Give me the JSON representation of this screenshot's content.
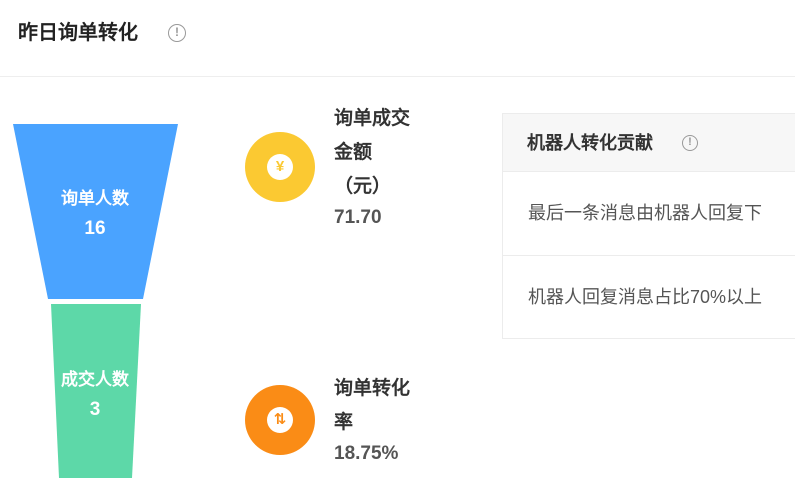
{
  "header": {
    "title": "昨日询单转化",
    "info_glyph": "!"
  },
  "funnel": [
    {
      "label": "询单人数",
      "value": "16",
      "color": "#4aa3ff"
    },
    {
      "label": "成交人数",
      "value": "3",
      "color": "#5dd8a8"
    }
  ],
  "metrics": [
    {
      "label_lines": [
        "询单成交",
        "金额",
        "（元）"
      ],
      "value": "71.70",
      "icon": "yen-icon",
      "icon_glyph": "¥",
      "color": "#fbc932"
    },
    {
      "label_lines": [
        "询单转化",
        "率"
      ],
      "value": "18.75%",
      "icon": "transfer-arrows-icon",
      "icon_glyph": "⇅",
      "color": "#fa8c16"
    }
  ],
  "robot_panel": {
    "title": "机器人转化贡献",
    "info_glyph": "!",
    "rows": [
      "最后一条消息由机器人回复下",
      "机器人回复消息占比70%以上"
    ]
  }
}
